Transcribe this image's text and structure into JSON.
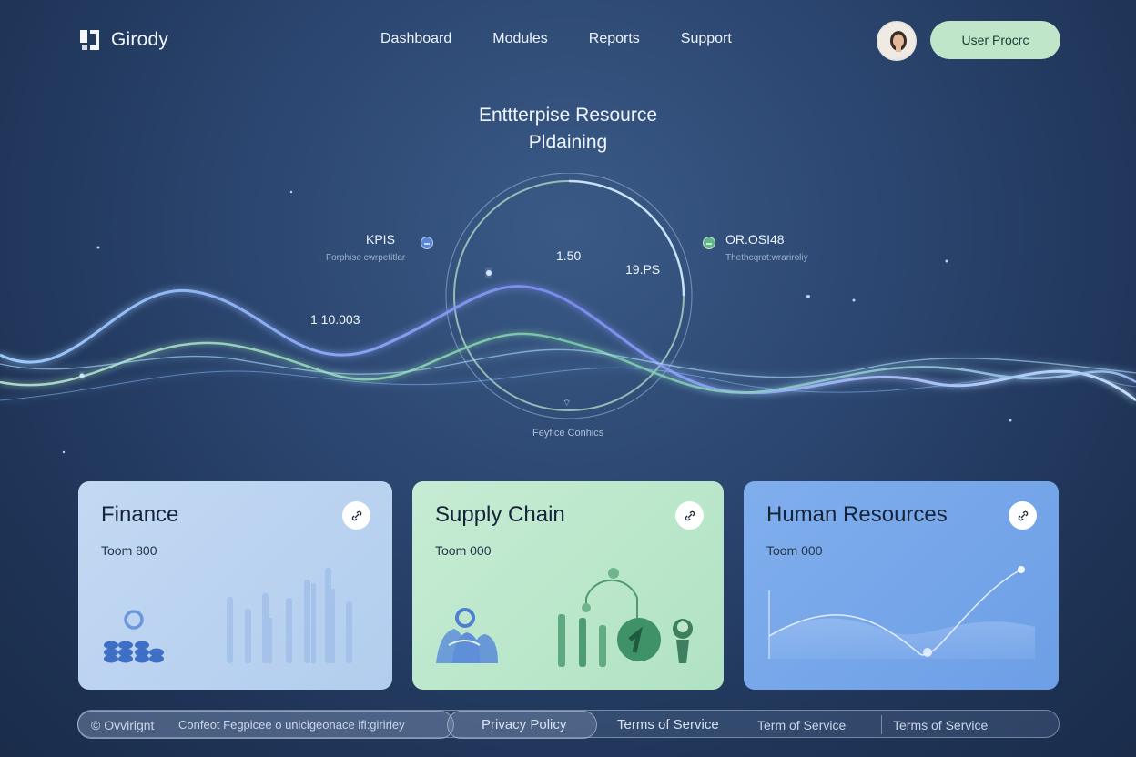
{
  "header": {
    "brand": "Girody",
    "nav": [
      "Dashboard",
      "Modules",
      "Reports",
      "Support"
    ],
    "user_button": "User Procrc"
  },
  "hero": {
    "title_line1": "Enttterpise Resource",
    "title_line2": "Pldaining",
    "left_kpi": {
      "label": "KPIS",
      "sub": "Forphise cwrpetitlar"
    },
    "right_kpi": {
      "label": "OR.OSI48",
      "sub": "Thethcqrat:wrariroliy"
    },
    "ring_value_a": "1.50",
    "ring_value_b": "19.PS",
    "wave_value": "1 10.003",
    "ring_caption": "Feyfice Conhics",
    "ring_marker": "⌔"
  },
  "cards": [
    {
      "title": "Finance",
      "subtitle": "Toom 800",
      "icon": "link-icon",
      "color": "#b8d2f0"
    },
    {
      "title": "Supply Chain",
      "subtitle": "Toom 000",
      "icon": "link-icon",
      "color": "#bde8cc"
    },
    {
      "title": "Human Resources",
      "subtitle": "Toom 000",
      "icon": "link-icon",
      "color": "#76a7ea"
    }
  ],
  "footer": {
    "copyright": "© Ovvirignt",
    "tagline": "Confeot Fegpicee o unicigeonace ifl:giririey",
    "privacy": "Privacy Policy",
    "terms1": "Terms of Service",
    "terms2": "Term of Service",
    "terms3": "Terms of Service"
  },
  "colors": {
    "accent_green": "#bfe6c9",
    "accent_blue": "#6fa0e8",
    "background": "#2b4670"
  }
}
